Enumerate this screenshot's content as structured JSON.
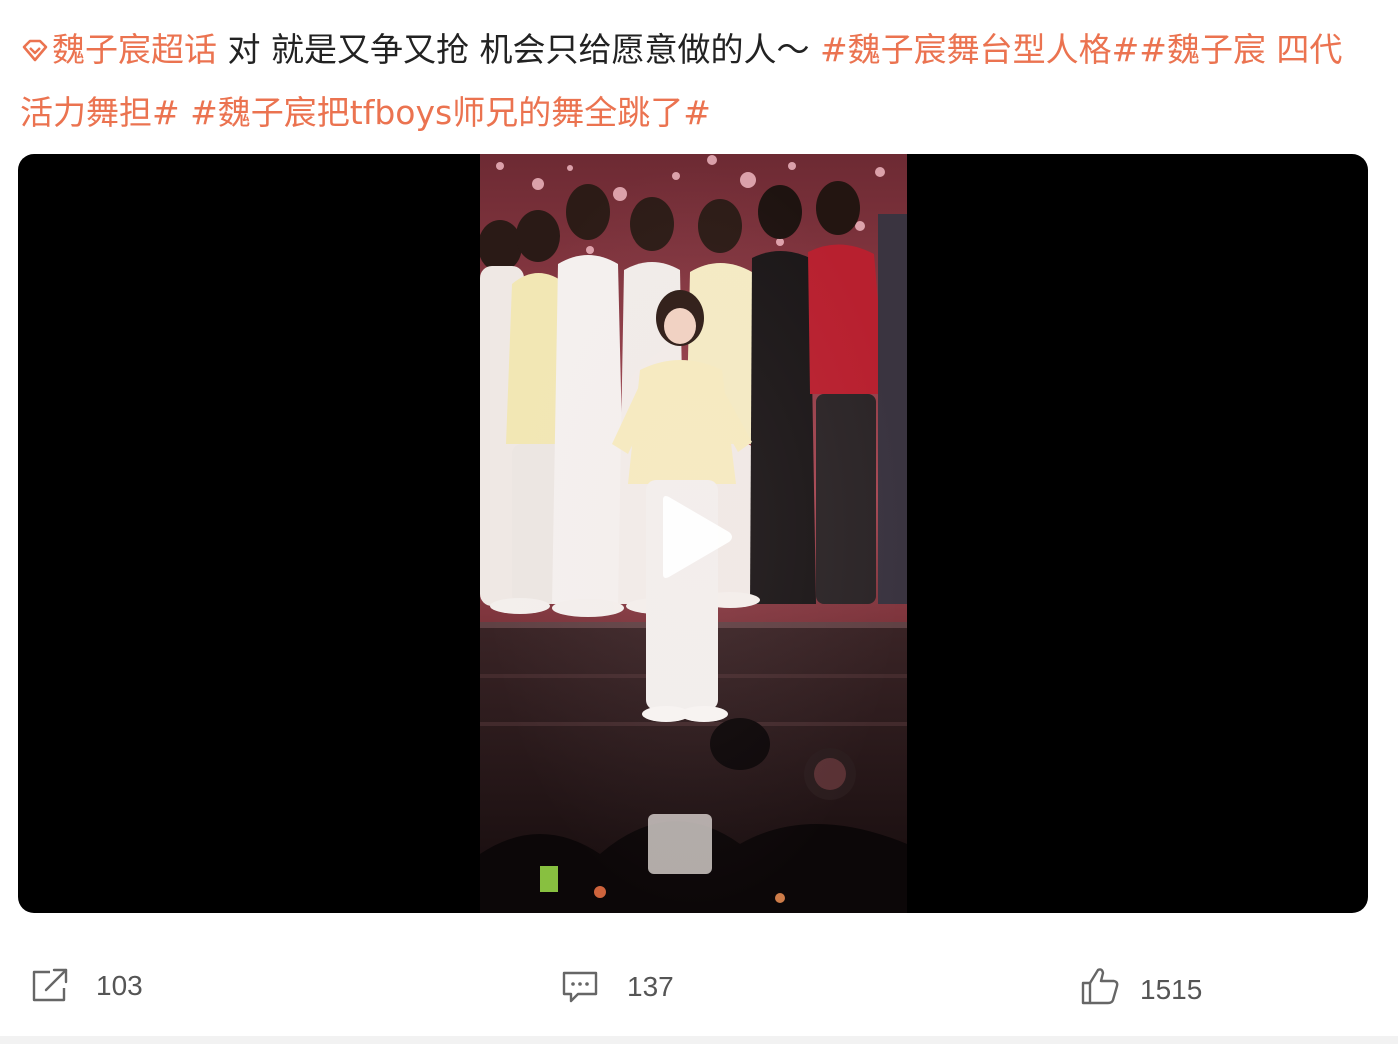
{
  "post": {
    "supertopic_icon": "diamond-supertopic-icon",
    "supertopic_label": "魏子宸超话",
    "body_text": " 对 就是又争又抢 机会只给愿意做的人～",
    "tags": [
      "#魏子宸舞台型人格#",
      "#魏子宸 四代活力舞担#",
      "#魏子宸把tfboys师兄的舞全跳了#"
    ]
  },
  "video": {
    "play_icon": "play-icon"
  },
  "actions": {
    "repost": {
      "icon": "share-icon",
      "count": "103"
    },
    "comment": {
      "icon": "comment-icon",
      "count": "137"
    },
    "like": {
      "icon": "thumbs-up-icon",
      "count": "1515"
    }
  },
  "colors": {
    "tag": "#eb7350",
    "text": "#222222",
    "video_bg": "#000000"
  }
}
